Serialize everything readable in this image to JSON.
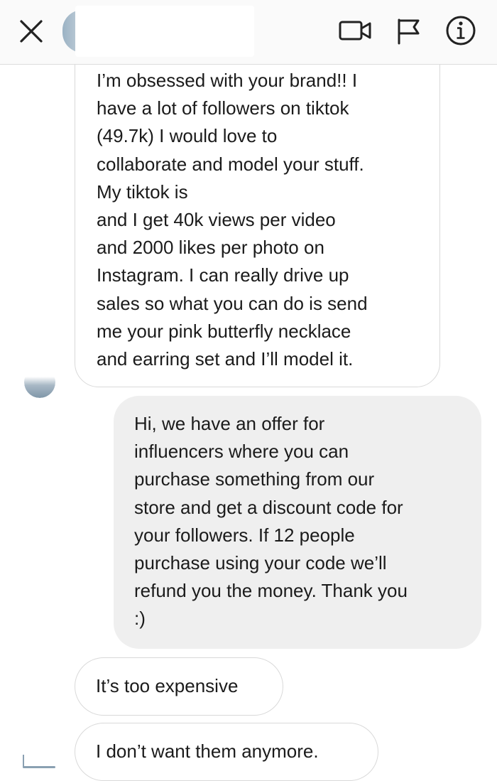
{
  "header": {
    "contact_name": ""
  },
  "messages": [
    {
      "direction": "incoming",
      "lines": [
        "I’m obsessed with your brand!! I",
        "have a lot of followers on tiktok",
        "(49.7k) I would love to",
        "collaborate and model your stuff.",
        "My tiktok is",
        "and I get 40k views per video",
        "and 2000 likes per photo on",
        "Instagram. I can really drive up",
        "sales so what you can do is send",
        "me your pink butterfly necklace",
        "and earring set and I’ll model it."
      ]
    },
    {
      "direction": "outgoing",
      "lines": [
        "Hi, we have an offer for",
        "influencers where you can",
        "purchase something from our",
        "store and get a discount code for",
        "your followers. If 12 people",
        "purchase using your code we’ll",
        "refund you the money. Thank you",
        ":)"
      ]
    },
    {
      "direction": "incoming",
      "lines": [
        "It’s too expensive"
      ]
    },
    {
      "direction": "incoming",
      "lines": [
        "I don’t want them anymore."
      ]
    }
  ],
  "icons": {
    "close": "close-icon",
    "video": "video-call-icon",
    "flag": "flag-icon",
    "info": "info-icon"
  },
  "colors": {
    "header_bg": "#fafafa",
    "outgoing_bubble": "#efefef",
    "incoming_border": "#d9d9d9",
    "text": "#1b1b1b"
  }
}
